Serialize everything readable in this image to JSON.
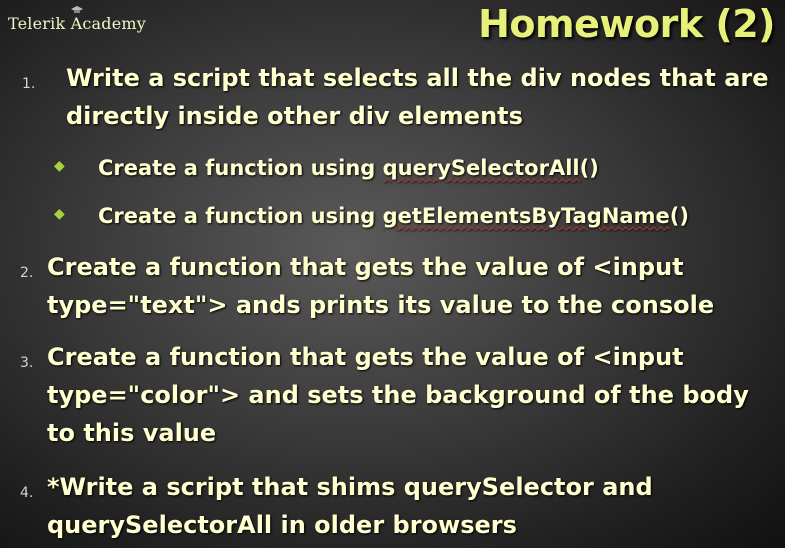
{
  "header": {
    "logo_text": "Telerik Academy",
    "title": "Homework (2)"
  },
  "items": [
    {
      "number": "1.",
      "line1": "Write a script that selects all the div nodes that are",
      "line2": "directly inside other div elements",
      "subitems": [
        {
          "prefix": "Create a function using ",
          "code": "querySelectorAll",
          "suffix": "()"
        },
        {
          "prefix": "Create a function using ",
          "code": "getElementsByTagName",
          "suffix": "()"
        }
      ]
    },
    {
      "number": "2.",
      "line1": "Create a function that gets the value of <input",
      "line2": "type=\"text\"> ands prints its value to the console"
    },
    {
      "number": "3.",
      "line1": "Create a function that gets the value of <input",
      "line2": "type=\"color\"> and sets the background of the body",
      "line3": "to this value"
    },
    {
      "number": "4.",
      "line1": "*Write a script that shims querySelector and",
      "line2": "querySelectorAll in older browsers"
    }
  ],
  "colors": {
    "title": "#e6f07a",
    "text": "#ffffd0",
    "bullet": "#a8d23c",
    "number": "#c9d5e0"
  }
}
